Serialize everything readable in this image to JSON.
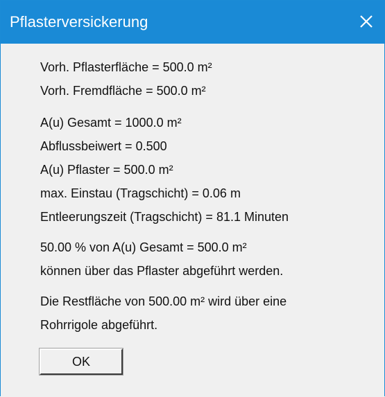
{
  "window": {
    "title": "Pflasterversickerung",
    "close_glyph": "✕"
  },
  "lines": [
    "Vorh. Pflasterfläche = 500.0 m²",
    "Vorh. Fremdfläche = 500.0 m²",
    "A(u) Gesamt = 1000.0 m²",
    "Abflussbeiwert = 0.500",
    "A(u) Pflaster = 500.0 m²",
    "max. Einstau (Tragschicht) = 0.06 m",
    "Entleerungszeit (Tragschicht) = 81.1 Minuten",
    "50.00 % von A(u) Gesamt = 500.0 m²",
    "können über das Pflaster abgeführt werden.",
    "Die Restfläche von 500.00 m² wird über eine",
    "Rohrrigole abgeführt."
  ],
  "buttons": {
    "ok_label": "OK"
  },
  "colors": {
    "titlebar": "#1a8ad6",
    "title_text": "#ffffff",
    "body_bg": "#f0f0f0"
  }
}
